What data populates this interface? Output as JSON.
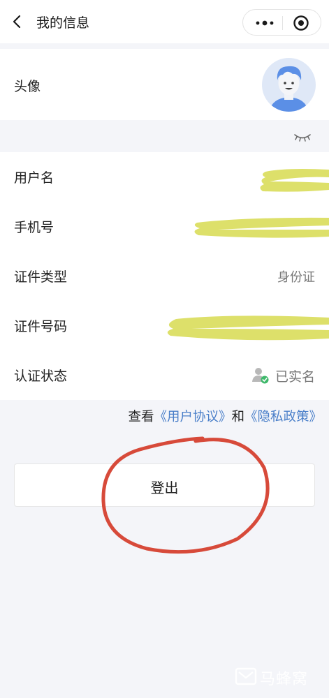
{
  "header": {
    "title": "我的信息",
    "back_icon": "chevron-left-icon",
    "more_icon": "more-dots-icon",
    "close_icon": "target-circle-icon"
  },
  "avatar": {
    "label": "头像",
    "image": "cartoon-avatar-icon"
  },
  "privacy_toggle_icon": "closed-eye-icon",
  "info": [
    {
      "label": "用户名",
      "value": ""
    },
    {
      "label": "手机号",
      "value": ""
    },
    {
      "label": "证件类型",
      "value": "身份证"
    },
    {
      "label": "证件号码",
      "value": ""
    },
    {
      "label": "认证状态",
      "value": "已实名",
      "icon": "verified-user-icon"
    }
  ],
  "agreement": {
    "prefix": "查看",
    "user_link": "《用户协议》",
    "connector": "和",
    "privacy_link": "《隐私政策》"
  },
  "logout": {
    "label": "登出"
  },
  "watermark": {
    "text": "马蜂窝"
  },
  "colors": {
    "page_bg": "#f4f5f9",
    "card_bg": "#ffffff",
    "link": "#4a7fc9",
    "highlight": "#dde06a",
    "annotation_circle": "#d74a3a"
  }
}
